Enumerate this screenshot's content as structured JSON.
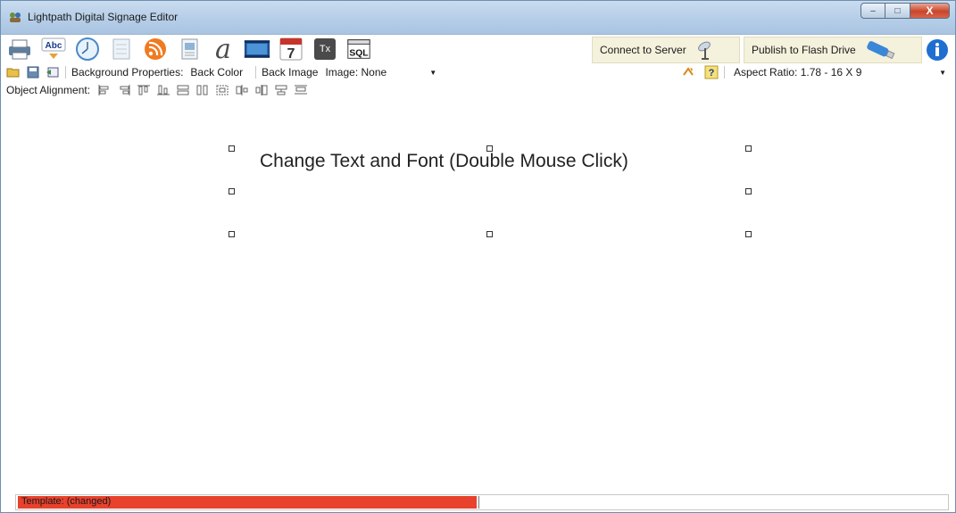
{
  "window": {
    "title": "Lightpath Digital Signage Editor",
    "buttons": {
      "minimize": "–",
      "maximize": "□",
      "close": "X"
    }
  },
  "toolbar": {
    "abc_label": "Abc",
    "tx_label": "Tx",
    "sql_label": "SQL",
    "calendar_day": "7",
    "font_glyph": "a",
    "connect_label": "Connect to Server",
    "publish_label": "Publish to Flash Drive"
  },
  "properties_bar": {
    "background_label": "Background Properties:",
    "back_color": "Back Color",
    "back_image": "Back Image",
    "image_value": "Image: None",
    "aspect_ratio": "Aspect Ratio: 1.78 - 16 X 9"
  },
  "alignment_bar": {
    "label": "Object Alignment:"
  },
  "canvas": {
    "text_object": "Change Text and Font (Double Mouse Click)"
  },
  "status": {
    "text": "Template: (changed)",
    "progress_color": "#e8412c"
  },
  "colors": {
    "titlebar": "#b7cfe8",
    "panel": "#f4f1dc",
    "close": "#c9452b",
    "info": "#1f6fd1"
  }
}
